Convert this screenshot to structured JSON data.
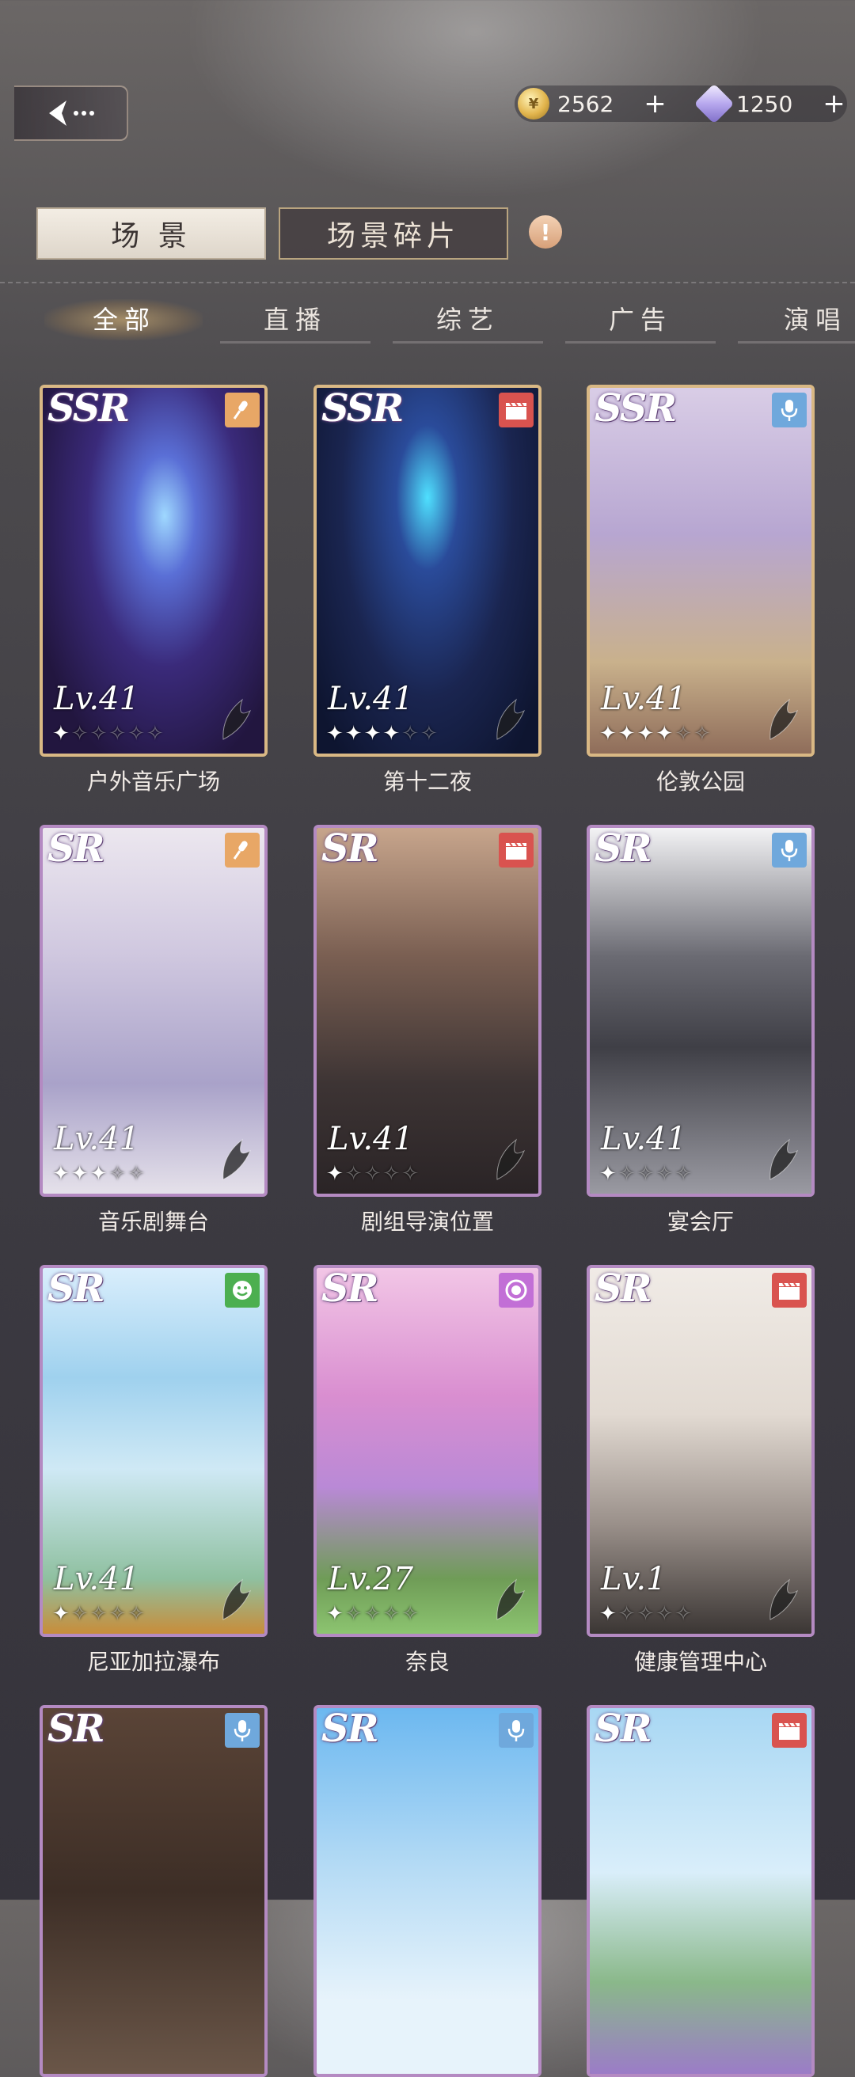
{
  "header": {
    "coins": "2562",
    "gems": "1250",
    "plus": "+"
  },
  "main_tabs": [
    {
      "label": "场 景",
      "active": true
    },
    {
      "label": "场景碎片",
      "active": false
    }
  ],
  "alert_symbol": "!",
  "category_tabs": [
    {
      "label": "全部",
      "active": true
    },
    {
      "label": "直播",
      "active": false
    },
    {
      "label": "综艺",
      "active": false
    },
    {
      "label": "广告",
      "active": false
    },
    {
      "label": "演唱",
      "active": false
    }
  ],
  "cards": [
    {
      "name": "户外音乐广场",
      "rarity": "SSR",
      "level": "Lv.41",
      "stars": 1,
      "max_stars": 6,
      "type_icon": "microphone-icon",
      "badge_color": "#e8a766"
    },
    {
      "name": "第十二夜",
      "rarity": "SSR",
      "level": "Lv.41",
      "stars": 4,
      "max_stars": 6,
      "type_icon": "clapperboard-icon",
      "badge_color": "#d9534f"
    },
    {
      "name": "伦敦公园",
      "rarity": "SSR",
      "level": "Lv.41",
      "stars": 4,
      "max_stars": 6,
      "type_icon": "podcast-mic-icon",
      "badge_color": "#6fa8dc"
    },
    {
      "name": "音乐剧舞台",
      "rarity": "SR",
      "level": "Lv.41",
      "stars": 3,
      "max_stars": 5,
      "type_icon": "microphone-icon",
      "badge_color": "#e8a766"
    },
    {
      "name": "剧组导演位置",
      "rarity": "SR",
      "level": "Lv.41",
      "stars": 1,
      "max_stars": 5,
      "type_icon": "clapperboard-icon",
      "badge_color": "#d9534f"
    },
    {
      "name": "宴会厅",
      "rarity": "SR",
      "level": "Lv.41",
      "stars": 1,
      "max_stars": 5,
      "type_icon": "podcast-mic-icon",
      "badge_color": "#6fa8dc"
    },
    {
      "name": "尼亚加拉瀑布",
      "rarity": "SR",
      "level": "Lv.41",
      "stars": 1,
      "max_stars": 5,
      "type_icon": "smile-icon",
      "badge_color": "#4caf50"
    },
    {
      "name": "奈良",
      "rarity": "SR",
      "level": "Lv.27",
      "stars": 1,
      "max_stars": 5,
      "type_icon": "live-record-icon",
      "badge_color": "#c26fd6"
    },
    {
      "name": "健康管理中心",
      "rarity": "SR",
      "level": "Lv.1",
      "stars": 1,
      "max_stars": 5,
      "type_icon": "clapperboard-icon",
      "badge_color": "#d9534f"
    },
    {
      "name": "",
      "rarity": "SR",
      "level": "",
      "stars": 0,
      "max_stars": 0,
      "type_icon": "podcast-mic-icon",
      "badge_color": "#6fa8dc"
    },
    {
      "name": "",
      "rarity": "SR",
      "level": "",
      "stars": 0,
      "max_stars": 0,
      "type_icon": "podcast-mic-icon",
      "badge_color": "#6fa8dc"
    },
    {
      "name": "",
      "rarity": "SR",
      "level": "",
      "stars": 0,
      "max_stars": 0,
      "type_icon": "clapperboard-icon",
      "badge_color": "#d9534f"
    }
  ]
}
